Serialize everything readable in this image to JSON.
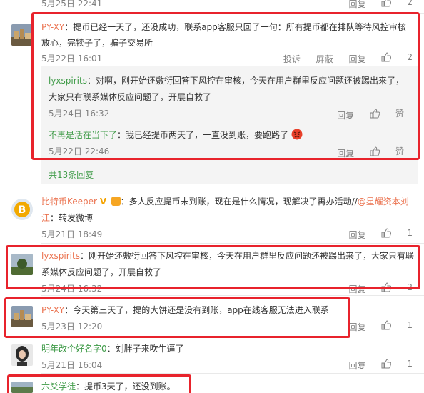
{
  "labels": {
    "report": "投诉",
    "block": "屏蔽",
    "reply": "回复",
    "like": "赞",
    "colon": "："
  },
  "top_partial": {
    "date": "5月25日 22:41",
    "reply": "回复",
    "likes": "2"
  },
  "comments": [
    {
      "user": "PY-XY",
      "text_1": "提币已经一天了，还没成功，联系app客服只回了一句：所有提币都在排队等待风控审核",
      "text_2": "放心，完犊子了，骗子交易所",
      "date": "5月22日 16:01",
      "likes": "2",
      "replies": [
        {
          "user": "lyxspirits",
          "text_1": "对啊，刚开始还敷衍回答下风控在审核，今天在用户群里反应问题还被踢出来了，",
          "text_2": "大家只有联系媒体反应问题了，开展自救了",
          "date": "5月24日 16:32"
        },
        {
          "user": "不再是活在当下了",
          "text_1": "我已经提币两天了，一直没到账，要跑路了",
          "emoji": "angry-face-emoji",
          "date": "5月22日 22:46"
        }
      ],
      "more_replies": "共13条回复"
    },
    {
      "user": "比特币Keeper",
      "text_1": "多人反应提币未到账，现在是什么情况，现解决了再办活动//",
      "mention": "@星耀资本刘",
      "text_2_mention": "江",
      "text_2": "转发微博",
      "date": "5月21日 18:49",
      "likes": "1"
    },
    {
      "user": "lyxspirits",
      "text_1": "刚开始还敷衍回答下风控在审核，今天在用户群里反应问题还被踢出来了，大家只有联",
      "text_2": "系媒体反应问题了，开展自救了",
      "date": "5月24日 16:32",
      "likes": "2"
    },
    {
      "user": "PY-XY",
      "text_1": "今天第三天了，提的大饼还是没有到账，app在线客服无法进入联系",
      "date": "5月23日 12:20",
      "likes": "1"
    },
    {
      "user": "明年改个好名字0",
      "text_1": "刘胖子来吹牛逼了",
      "date": "5月21日 16:04",
      "likes": "1"
    },
    {
      "user": "六爻学徒",
      "text_1": "提币3天了，还没到账。"
    }
  ],
  "colors": {
    "username": "#eb7350",
    "username_green": "#3f9b48",
    "highlight_box": "#e8232c",
    "subpanel_bg": "#f4f4f4"
  }
}
